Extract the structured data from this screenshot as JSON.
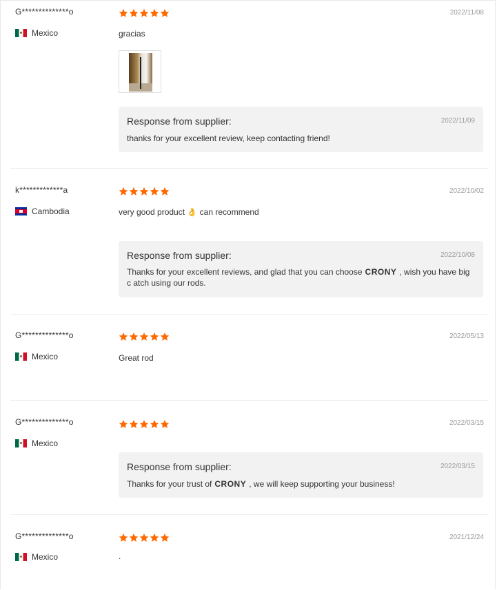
{
  "colors": {
    "star": "#ff6a00",
    "date": "#999999",
    "response_bg": "#f2f2f2"
  },
  "reviews": [
    {
      "user": "G**************o",
      "country": "Mexico",
      "flag_icon": "mexico-flag-icon",
      "rating": 5,
      "date": "2022/11/08",
      "text": "gracias",
      "has_photo": true,
      "response": {
        "title": "Response from supplier:",
        "date": "2022/11/09",
        "text": "thanks for your excellent review, keep contacting friend!"
      }
    },
    {
      "user": "k*************a",
      "country": "Cambodia",
      "flag_icon": "cambodia-flag-icon",
      "rating": 5,
      "date": "2022/10/02",
      "text": "very good product 👌 can recommend",
      "response": {
        "title": "Response from supplier:",
        "date": "2022/10/08",
        "text_before": "Thanks for your excellent reviews, and glad that you can choose",
        "brand": "CRONY",
        "text_after": ", wish you have big c atch using our rods."
      }
    },
    {
      "user": "G**************o",
      "country": "Mexico",
      "flag_icon": "mexico-flag-icon",
      "rating": 5,
      "date": "2022/05/13",
      "text": "Great rod"
    },
    {
      "user": "G**************o",
      "country": "Mexico",
      "flag_icon": "mexico-flag-icon",
      "rating": 5,
      "date": "2022/03/15",
      "response": {
        "title": "Response from supplier:",
        "date": "2022/03/15",
        "text_before": "Thanks for your trust of",
        "brand": "CRONY",
        "text_after": ", we will keep supporting your business!"
      }
    },
    {
      "user": "G**************o",
      "country": "Mexico",
      "flag_icon": "mexico-flag-icon",
      "rating": 5,
      "date": "2021/12/24",
      "text": "."
    }
  ]
}
